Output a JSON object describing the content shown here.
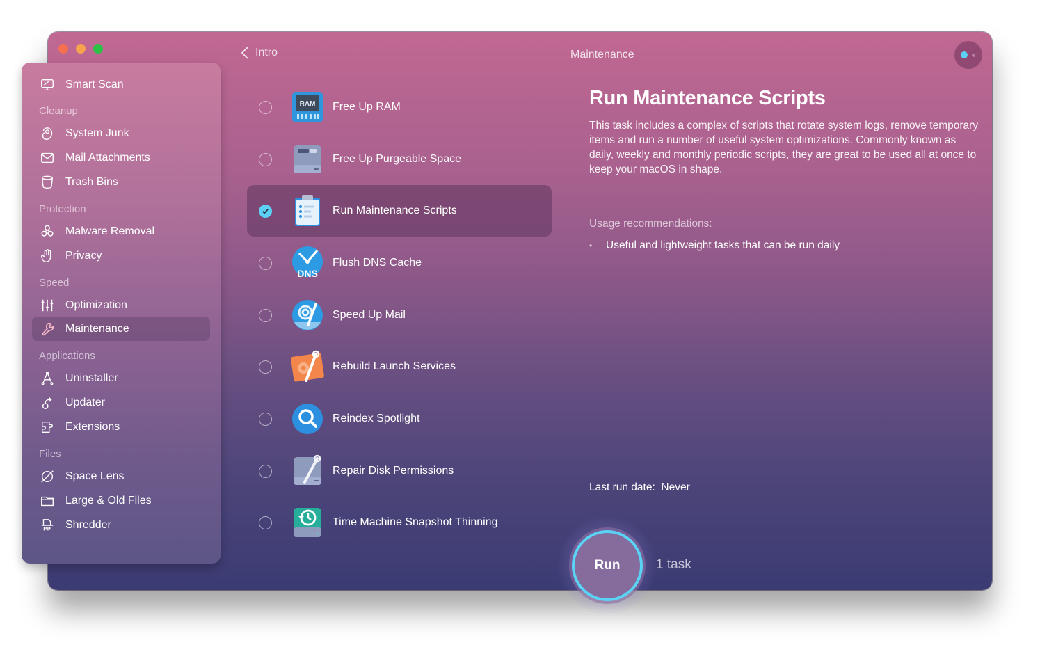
{
  "window": {
    "traffic_lights": [
      "close",
      "minimize",
      "maximize"
    ]
  },
  "header": {
    "back_label": "Intro",
    "title": "Maintenance",
    "assistant_icon": "assistant-dots-icon"
  },
  "sidebar": {
    "top_item": {
      "label": "Smart Scan",
      "icon": "monitor-scan-icon"
    },
    "sections": [
      {
        "title": "Cleanup",
        "items": [
          {
            "label": "System Junk",
            "icon": "system-junk-icon"
          },
          {
            "label": "Mail Attachments",
            "icon": "envelope-icon"
          },
          {
            "label": "Trash Bins",
            "icon": "trash-bin-icon"
          }
        ]
      },
      {
        "title": "Protection",
        "items": [
          {
            "label": "Malware Removal",
            "icon": "biohazard-icon"
          },
          {
            "label": "Privacy",
            "icon": "hand-icon"
          }
        ]
      },
      {
        "title": "Speed",
        "items": [
          {
            "label": "Optimization",
            "icon": "sliders-icon"
          },
          {
            "label": "Maintenance",
            "icon": "wrench-icon",
            "active": true
          }
        ]
      },
      {
        "title": "Applications",
        "items": [
          {
            "label": "Uninstaller",
            "icon": "uninstaller-icon"
          },
          {
            "label": "Updater",
            "icon": "update-arrow-icon"
          },
          {
            "label": "Extensions",
            "icon": "puzzle-icon"
          }
        ]
      },
      {
        "title": "Files",
        "items": [
          {
            "label": "Space Lens",
            "icon": "planet-icon"
          },
          {
            "label": "Large & Old Files",
            "icon": "folder-icon"
          },
          {
            "label": "Shredder",
            "icon": "shredder-icon"
          }
        ]
      }
    ]
  },
  "tasks": [
    {
      "label": "Free Up RAM",
      "icon": "ram-icon",
      "checked": false
    },
    {
      "label": "Free Up Purgeable Space",
      "icon": "drive-icon",
      "checked": false
    },
    {
      "label": "Run Maintenance Scripts",
      "icon": "clipboard-icon",
      "checked": true
    },
    {
      "label": "Flush DNS Cache",
      "icon": "dns-icon",
      "checked": false
    },
    {
      "label": "Speed Up Mail",
      "icon": "mail-speed-icon",
      "checked": false
    },
    {
      "label": "Rebuild Launch Services",
      "icon": "launch-services-icon",
      "checked": false
    },
    {
      "label": "Reindex Spotlight",
      "icon": "spotlight-icon",
      "checked": false
    },
    {
      "label": "Repair Disk Permissions",
      "icon": "disk-repair-icon",
      "checked": false
    },
    {
      "label": "Time Machine Snapshot Thinning",
      "icon": "time-machine-icon",
      "checked": false
    }
  ],
  "detail": {
    "title": "Run Maintenance Scripts",
    "description": "This task includes a complex of scripts that rotate system logs, remove temporary items and run a number of useful system optimizations. Commonly known as daily, weekly and monthly periodic scripts, they are great to be used all at once to keep your macOS in shape.",
    "usage_title": "Usage recommendations:",
    "usage_items": [
      "Useful and lightweight tasks that can be run daily"
    ],
    "last_run_label": "Last run date:",
    "last_run_value": "Never"
  },
  "footer": {
    "run_label": "Run",
    "task_count": "1 task"
  },
  "colors": {
    "accent": "#5ccff5",
    "close": "#f5704f",
    "minimize": "#f7a24d",
    "maximize": "#2cc246"
  }
}
